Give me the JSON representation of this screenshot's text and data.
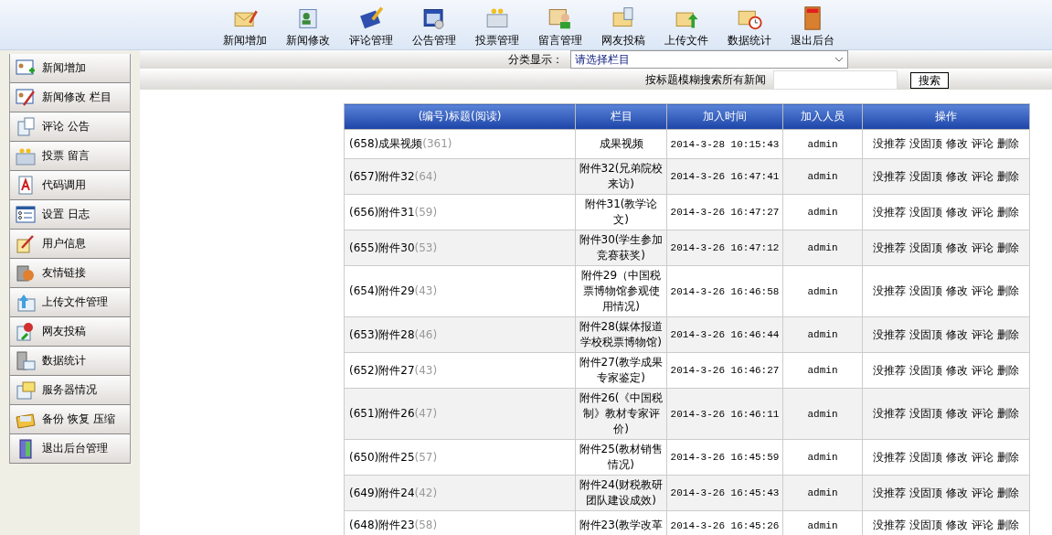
{
  "toolbar": [
    {
      "label": "新闻增加"
    },
    {
      "label": "新闻修改"
    },
    {
      "label": "评论管理"
    },
    {
      "label": "公告管理"
    },
    {
      "label": "投票管理"
    },
    {
      "label": "留言管理"
    },
    {
      "label": "网友投稿"
    },
    {
      "label": "上传文件"
    },
    {
      "label": "数据统计"
    },
    {
      "label": "退出后台"
    }
  ],
  "sidebar": {
    "items": [
      {
        "label": "新闻增加"
      },
      {
        "label": "新闻修改 栏目"
      },
      {
        "label": "评论 公告"
      },
      {
        "label": "投票 留言"
      },
      {
        "label": "代码调用"
      },
      {
        "label": "设置 日志"
      },
      {
        "label": "用户信息"
      },
      {
        "label": "友情链接"
      },
      {
        "label": "上传文件管理"
      },
      {
        "label": "网友投稿"
      },
      {
        "label": "数据统计"
      },
      {
        "label": "服务器情况"
      },
      {
        "label": "备份 恢复 压缩"
      },
      {
        "label": "退出后台管理"
      }
    ]
  },
  "filter": {
    "label": "分类显示：",
    "select_value": "请选择栏目"
  },
  "search": {
    "label": "按标题模糊搜索所有新闻",
    "button": "搜索"
  },
  "table": {
    "columns": [
      "(编号)标题(阅读)",
      "栏目",
      "加入时间",
      "加入人员",
      "操作"
    ],
    "rows": [
      {
        "title": "(658)成果视频",
        "reads": "(361)",
        "category": "成果视频",
        "time": "2014-3-28 10:15:43",
        "user": "admin",
        "actions": [
          "没推荐",
          "没固顶",
          "修改",
          "评论",
          "删除"
        ]
      },
      {
        "title": "(657)附件32",
        "reads": "(64)",
        "category": "附件32(兄弟院校来访)",
        "time": "2014-3-26 16:47:41",
        "user": "admin",
        "actions": [
          "没推荐",
          "没固顶",
          "修改",
          "评论",
          "删除"
        ]
      },
      {
        "title": "(656)附件31",
        "reads": "(59)",
        "category": "附件31(教学论文)",
        "time": "2014-3-26 16:47:27",
        "user": "admin",
        "actions": [
          "没推荐",
          "没固顶",
          "修改",
          "评论",
          "删除"
        ]
      },
      {
        "title": "(655)附件30",
        "reads": "(53)",
        "category": "附件30(学生参加竞赛获奖)",
        "time": "2014-3-26 16:47:12",
        "user": "admin",
        "actions": [
          "没推荐",
          "没固顶",
          "修改",
          "评论",
          "删除"
        ]
      },
      {
        "title": "(654)附件29",
        "reads": "(43)",
        "category": "附件29（中国税票博物馆参观使用情况)",
        "time": "2014-3-26 16:46:58",
        "user": "admin",
        "actions": [
          "没推荐",
          "没固顶",
          "修改",
          "评论",
          "删除"
        ]
      },
      {
        "title": "(653)附件28",
        "reads": "(46)",
        "category": "附件28(媒体报道学校税票博物馆)",
        "time": "2014-3-26 16:46:44",
        "user": "admin",
        "actions": [
          "没推荐",
          "没固顶",
          "修改",
          "评论",
          "删除"
        ]
      },
      {
        "title": "(652)附件27",
        "reads": "(43)",
        "category": "附件27(教学成果专家鉴定)",
        "time": "2014-3-26 16:46:27",
        "user": "admin",
        "actions": [
          "没推荐",
          "没固顶",
          "修改",
          "评论",
          "删除"
        ]
      },
      {
        "title": "(651)附件26",
        "reads": "(47)",
        "category": "附件26(《中国税制》教材专家评价)",
        "time": "2014-3-26 16:46:11",
        "user": "admin",
        "actions": [
          "没推荐",
          "没固顶",
          "修改",
          "评论",
          "删除"
        ]
      },
      {
        "title": "(650)附件25",
        "reads": "(57)",
        "category": "附件25(教材销售情况)",
        "time": "2014-3-26 16:45:59",
        "user": "admin",
        "actions": [
          "没推荐",
          "没固顶",
          "修改",
          "评论",
          "删除"
        ]
      },
      {
        "title": "(649)附件24",
        "reads": "(42)",
        "category": "附件24(财税教研团队建设成效)",
        "time": "2014-3-26 16:45:43",
        "user": "admin",
        "actions": [
          "没推荐",
          "没固顶",
          "修改",
          "评论",
          "删除"
        ]
      },
      {
        "title": "(648)附件23",
        "reads": "(58)",
        "category": "附件23(教学改革",
        "time": "2014-3-26 16:45:26",
        "user": "admin",
        "actions": [
          "没推荐",
          "没固顶",
          "修改",
          "评论",
          "删除"
        ]
      }
    ]
  }
}
